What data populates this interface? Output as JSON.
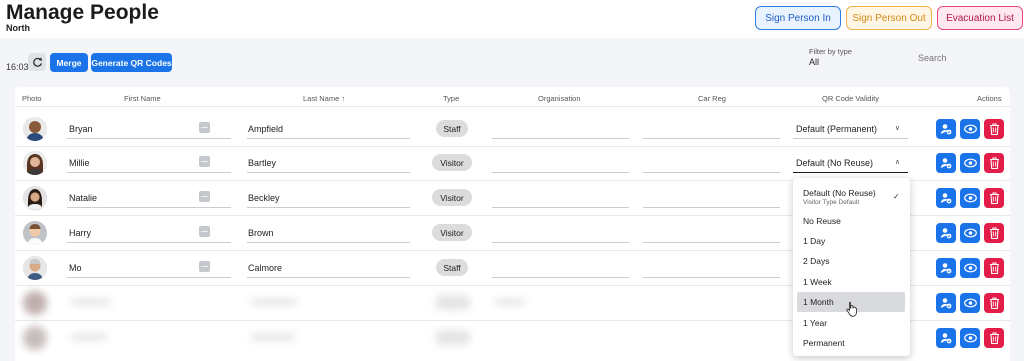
{
  "header": {
    "title": "Manage People",
    "subtitle": "North",
    "buttons": {
      "sign_in": "Sign Person In",
      "sign_out": "Sign Person Out",
      "evacuation": "Evacuation List"
    }
  },
  "toolbar": {
    "time": "16:03",
    "merge": "Merge",
    "generate_qr": "Generate QR Codes",
    "filter_label": "Filter by type",
    "filter_value": "All",
    "search_placeholder": "Search"
  },
  "table": {
    "headers": {
      "photo": "Photo",
      "first_name": "First Name",
      "last_name": "Last Name",
      "type": "Type",
      "organisation": "Organisation",
      "car_reg": "Car Reg",
      "qr_validity": "QR Code Validity",
      "actions": "Actions"
    },
    "sort_indicator": "↑",
    "rows": [
      {
        "first": "Bryan",
        "last": "Ampfield",
        "type": "Staff",
        "organisation": "",
        "car_reg": "",
        "qr": "Default (Permanent)",
        "chevron": "∨"
      },
      {
        "first": "Millie",
        "last": "Bartley",
        "type": "Visitor",
        "organisation": "",
        "car_reg": "",
        "qr": "Default (No Reuse)",
        "chevron": "∧"
      },
      {
        "first": "Natalie",
        "last": "Beckley",
        "type": "Visitor",
        "organisation": "",
        "car_reg": "",
        "qr": "",
        "chevron": ""
      },
      {
        "first": "Harry",
        "last": "Brown",
        "type": "Visitor",
        "organisation": "",
        "car_reg": "",
        "qr": "",
        "chevron": ""
      },
      {
        "first": "Mo",
        "last": "Calmore",
        "type": "Staff",
        "organisation": "",
        "car_reg": "",
        "qr": "",
        "chevron": ""
      }
    ]
  },
  "dropdown": {
    "options": [
      {
        "label": "Default (No Reuse)",
        "sub": "Visitor Type Default"
      },
      {
        "label": "No Reuse"
      },
      {
        "label": "1 Day"
      },
      {
        "label": "2 Days"
      },
      {
        "label": "1 Week"
      },
      {
        "label": "1 Month"
      },
      {
        "label": "1 Year"
      },
      {
        "label": "Permanent"
      }
    ],
    "selected_mark": "✓"
  },
  "icons": {
    "refresh": "refresh-icon",
    "id_card": "id-card-icon",
    "user_check": "user-check-icon",
    "eye": "eye-icon",
    "trash": "trash-icon",
    "pointer": "hand-pointer-icon"
  },
  "colors": {
    "primary": "#1a73e8",
    "danger": "#e11d48",
    "sign_in": "#2f7de1",
    "sign_out": "#f0b44a",
    "evacuation": "#e8497a"
  }
}
